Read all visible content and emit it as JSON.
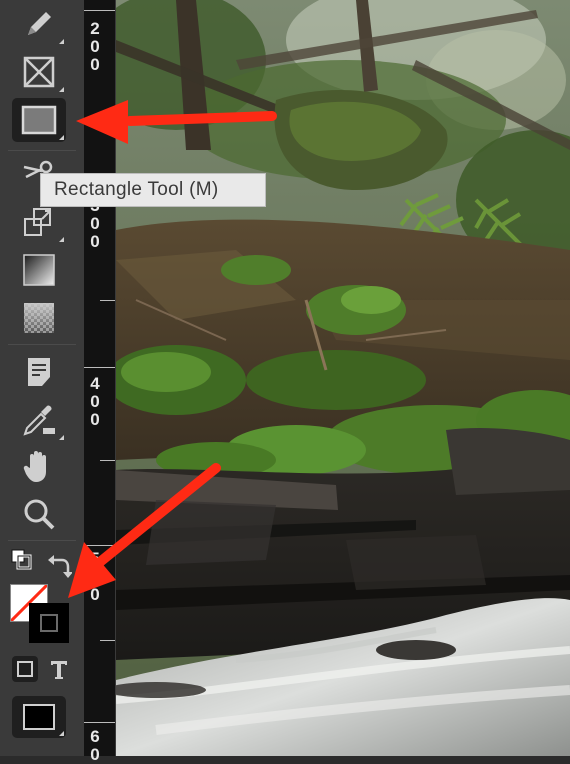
{
  "tooltip": {
    "text": "Rectangle Tool (M)"
  },
  "toolbar": {
    "tools": [
      {
        "name": "pen-tool",
        "icon": "pen-icon"
      },
      {
        "name": "frame-tool",
        "icon": "frame-icon"
      },
      {
        "name": "rectangle-tool",
        "icon": "rectangle-icon",
        "active": true
      },
      {
        "name": "scissors-tool",
        "icon": "scissors-icon"
      },
      {
        "name": "free-transform-tool",
        "icon": "transform-icon"
      },
      {
        "name": "gradient-swatch-tool",
        "icon": "gradient-icon"
      },
      {
        "name": "gradient-feather-tool",
        "icon": "feather-icon"
      },
      {
        "name": "note-tool",
        "icon": "note-icon"
      },
      {
        "name": "eyedropper-tool",
        "icon": "eyedropper-icon"
      },
      {
        "name": "hand-tool",
        "icon": "hand-icon"
      },
      {
        "name": "zoom-tool",
        "icon": "magnifier-icon"
      }
    ],
    "fill_stroke": {
      "fill": "none",
      "stroke": "#000000"
    }
  },
  "ruler": {
    "labels": [
      {
        "text": "200",
        "digits": [
          "2",
          "0",
          "0"
        ]
      },
      {
        "text": "300",
        "digits": [
          "3",
          "0",
          "0"
        ]
      },
      {
        "text": "400",
        "digits": [
          "4",
          "0",
          "0"
        ]
      },
      {
        "text": "5",
        "digits": [
          "5"
        ]
      },
      {
        "text": "0",
        "digits": [
          "0"
        ]
      },
      {
        "text": "60",
        "digits": [
          "6",
          "0"
        ]
      }
    ]
  },
  "colors": {
    "annotation_arrow": "#ff2a14",
    "toolbar_bg": "#3a3a3a",
    "ruler_bg": "#121212",
    "tooltip_bg": "#e9e9e9"
  }
}
